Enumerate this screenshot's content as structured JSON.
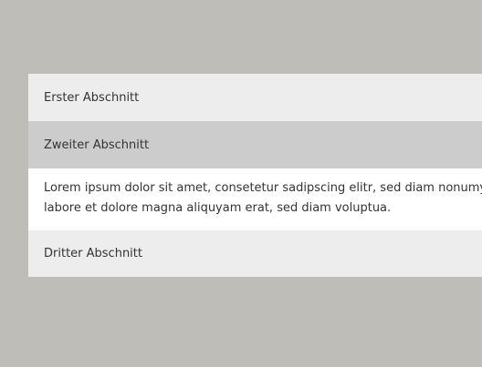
{
  "accordion": {
    "sections": [
      {
        "title": "Erster Abschnitt"
      },
      {
        "title": "Zweiter Abschnitt",
        "content_lines": [
          "Lorem ipsum dolor sit amet, consetetur sadipscing elitr, sed diam nonumy",
          "labore et dolore magna aliquyam erat, sed diam voluptua."
        ]
      },
      {
        "title": "Dritter Abschnitt"
      }
    ],
    "colors": {
      "page_background": "#bfbdb8",
      "header_background": "#ededed",
      "active_header_background": "#cccccc",
      "panel_background": "#ffffff",
      "text": "#333333"
    }
  }
}
